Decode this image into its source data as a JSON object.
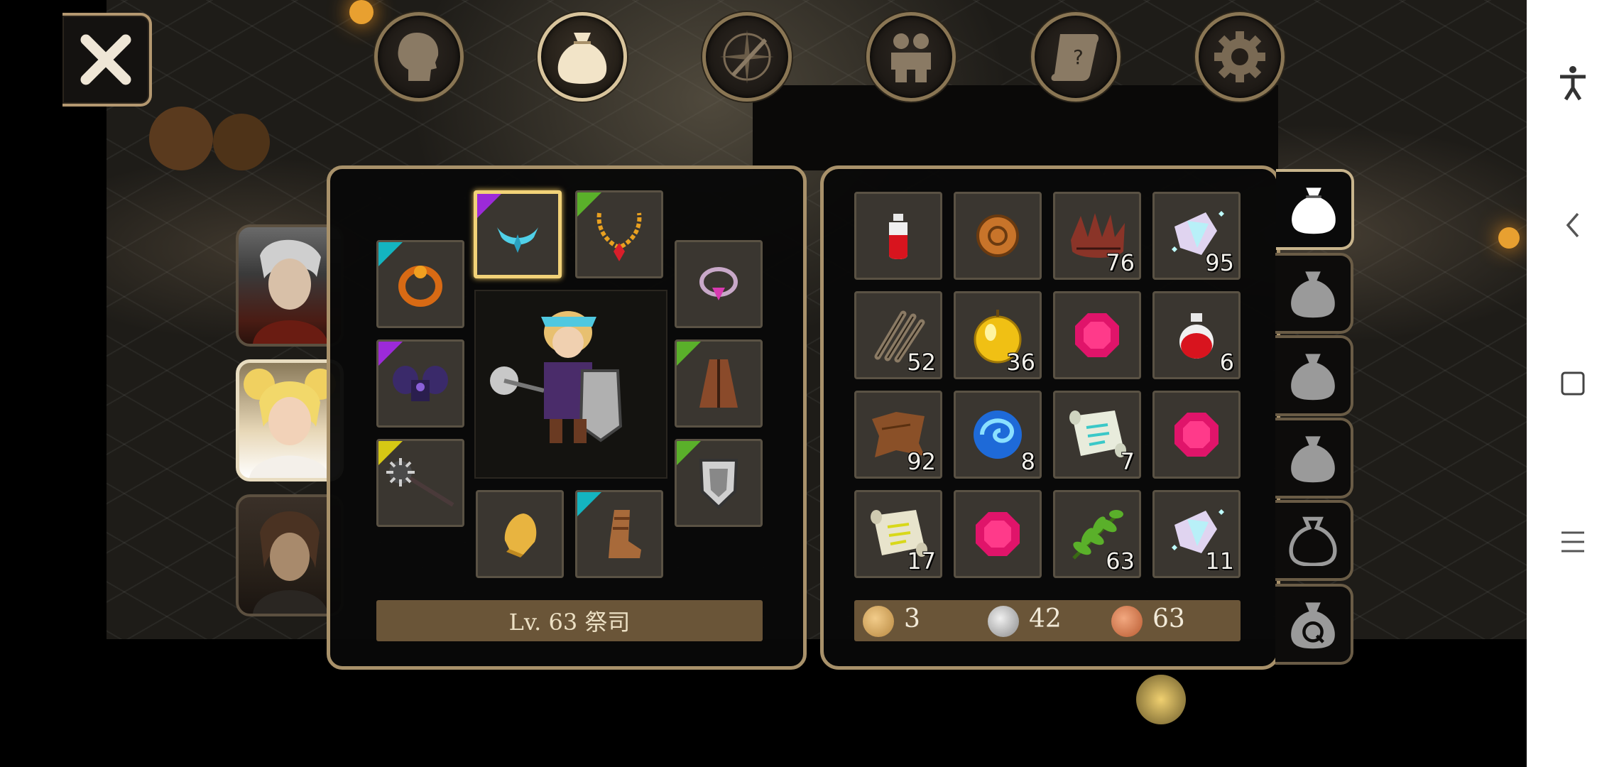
{
  "menu": {
    "close_icon": "close-x-icon",
    "tabs": [
      {
        "name": "character",
        "icon": "head-icon"
      },
      {
        "name": "inventory",
        "icon": "bag-icon"
      },
      {
        "name": "skills",
        "icon": "compass-sword-icon"
      },
      {
        "name": "party",
        "icon": "people-icon"
      },
      {
        "name": "quests",
        "icon": "scroll-icon"
      },
      {
        "name": "settings",
        "icon": "gear-icon"
      }
    ],
    "active_tab": "inventory"
  },
  "party": [
    {
      "name": "white-haired-warrior"
    },
    {
      "name": "blonde-priestess"
    },
    {
      "name": "dark-haired-rogue"
    }
  ],
  "character": {
    "level_label": "Lv. 63 祭司"
  },
  "equipment": {
    "slots": [
      {
        "slot": "tiara",
        "tier": "purple"
      },
      {
        "slot": "necklace",
        "tier": "green"
      },
      {
        "slot": "bracelet",
        "tier": "cyan"
      },
      {
        "slot": "ring",
        "tier": "none"
      },
      {
        "slot": "shoulder-armor",
        "tier": "purple"
      },
      {
        "slot": "cloak",
        "tier": "green"
      },
      {
        "slot": "mace",
        "tier": "yellow"
      },
      {
        "slot": "shield",
        "tier": "green"
      },
      {
        "slot": "gloves",
        "tier": "none"
      },
      {
        "slot": "boots",
        "tier": "cyan"
      }
    ]
  },
  "inventory": {
    "items": [
      {
        "icon": "red-potion",
        "qty": ""
      },
      {
        "icon": "bronze-coin",
        "qty": ""
      },
      {
        "icon": "spiked-shell",
        "qty": "76"
      },
      {
        "icon": "crystal-shard",
        "qty": "95"
      },
      {
        "icon": "claws",
        "qty": "52"
      },
      {
        "icon": "golden-apple",
        "qty": "36"
      },
      {
        "icon": "pink-gem",
        "qty": ""
      },
      {
        "icon": "red-potion-large",
        "qty": "6"
      },
      {
        "icon": "leather-hide",
        "qty": "92"
      },
      {
        "icon": "blue-swirl",
        "qty": "8"
      },
      {
        "icon": "blue-scroll",
        "qty": "7"
      },
      {
        "icon": "pink-gem",
        "qty": ""
      },
      {
        "icon": "yellow-scroll",
        "qty": "17"
      },
      {
        "icon": "pink-gem",
        "qty": ""
      },
      {
        "icon": "green-herb",
        "qty": "63"
      },
      {
        "icon": "crystal-shard",
        "qty": "11"
      }
    ],
    "bag_tabs": [
      "bag-1",
      "bag-2",
      "bag-3",
      "bag-4",
      "bag-5",
      "quest-bag"
    ],
    "active_bag": 0
  },
  "currency": {
    "gold": "3",
    "silver": "42",
    "copper": "63"
  },
  "colors": {
    "frame": "#a8916a",
    "slot_bg": "#3a3630",
    "tier_purple": "#9c2ad8",
    "tier_green": "#5ab02a",
    "tier_cyan": "#14b4c0",
    "tier_yellow": "#d6c814",
    "bar": "#6a5538"
  }
}
